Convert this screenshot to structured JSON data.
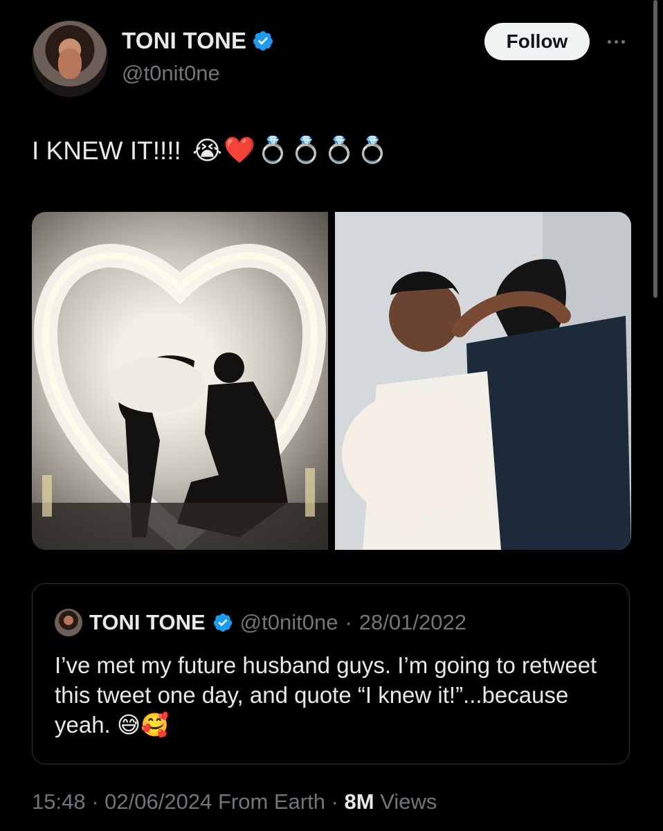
{
  "author": {
    "name": "TONI TONE",
    "handle": "@t0nit0ne",
    "verified_color": "#1d9bf0"
  },
  "actions": {
    "follow_label": "Follow",
    "more_icon": "more-horizontal-icon"
  },
  "tweet": {
    "text": "I KNEW IT!!!!",
    "emojis": [
      "😭",
      "❤️",
      "💍",
      "💍",
      "💍",
      "💍"
    ]
  },
  "media": {
    "count": 2,
    "photos": [
      "photo-proposal-silhouette",
      "photo-couple-embrace"
    ]
  },
  "quoted_tweet": {
    "name": "TONI TONE",
    "handle": "@t0nit0ne",
    "separator": "·",
    "date": "28/01/2022",
    "text": "I’ve met my future husband guys. I’m going to retweet this tweet one day, and quote “I knew it!”...because yeah. 😅🥰"
  },
  "footer": {
    "time": "15:48",
    "separator": "·",
    "date": "02/06/2024",
    "source": "From Earth",
    "views_count": "8M",
    "views_label": "Views"
  },
  "colors": {
    "background": "#000000",
    "text_primary": "#e7e9ea",
    "text_secondary": "#71767b",
    "border": "#2f3336",
    "follow_bg": "#eff3f4"
  }
}
